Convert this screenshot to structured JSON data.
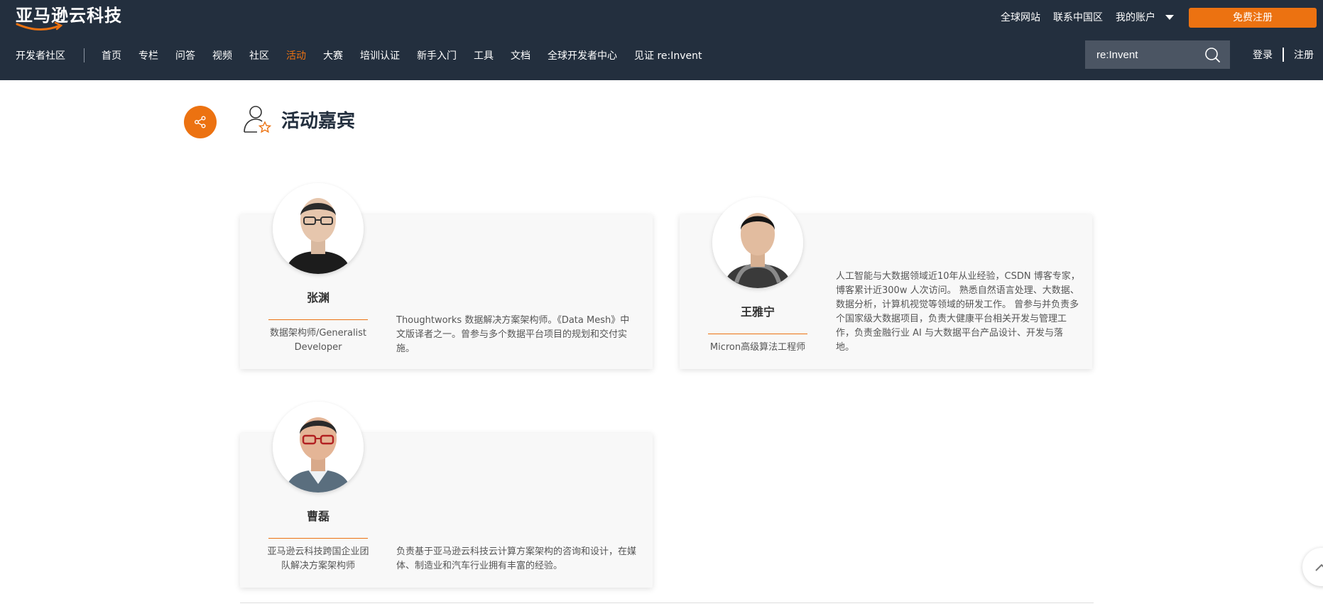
{
  "header": {
    "logo_text": "亚马逊云科技",
    "top_links": [
      "全球网站",
      "联系中国区",
      "我的账户"
    ],
    "register_button": "免费注册",
    "nav_brand": "开发者社区",
    "nav_items": [
      "首页",
      "专栏",
      "问答",
      "视频",
      "社区",
      "活动",
      "大赛",
      "培训认证",
      "新手入门",
      "工具",
      "文档",
      "全球开发者中心",
      "见证 re:Invent"
    ],
    "active_nav": "活动",
    "search_value": "re:Invent",
    "login": "登录",
    "signup": "注册",
    "accent_color": "#ec7211",
    "header_bg": "#232f3e"
  },
  "section": {
    "title": "活动嘉宾"
  },
  "speakers": [
    {
      "name": "张渊",
      "role": "数据架构师/Generalist Developer",
      "bio": "Thoughtworks 数据解决方案架构师。《Data Mesh》中文版译者之一。曾参与多个数据平台项目的规划和交付实施。"
    },
    {
      "name": "王雅宁",
      "role": "Micron高级算法工程师",
      "bio": "人工智能与大数据领域近10年从业经验，CSDN 博客专家，博客累计近300w 人次访问。 熟悉自然语言处理、大数据、数据分析，计算机视觉等领域的研发工作。 曾参与并负责多个国家级大数据项目，负责大健康平台相关开发与管理工作，负责金融行业 AI 与大数据平台产品设计、开发与落地。"
    },
    {
      "name": "曹磊",
      "role": "亚马逊云科技跨国企业团队解决方案架构师",
      "bio": "负责基于亚马逊云科技云计算方案架构的咨询和设计，在媒体、制造业和汽车行业拥有丰富的经验。"
    }
  ]
}
